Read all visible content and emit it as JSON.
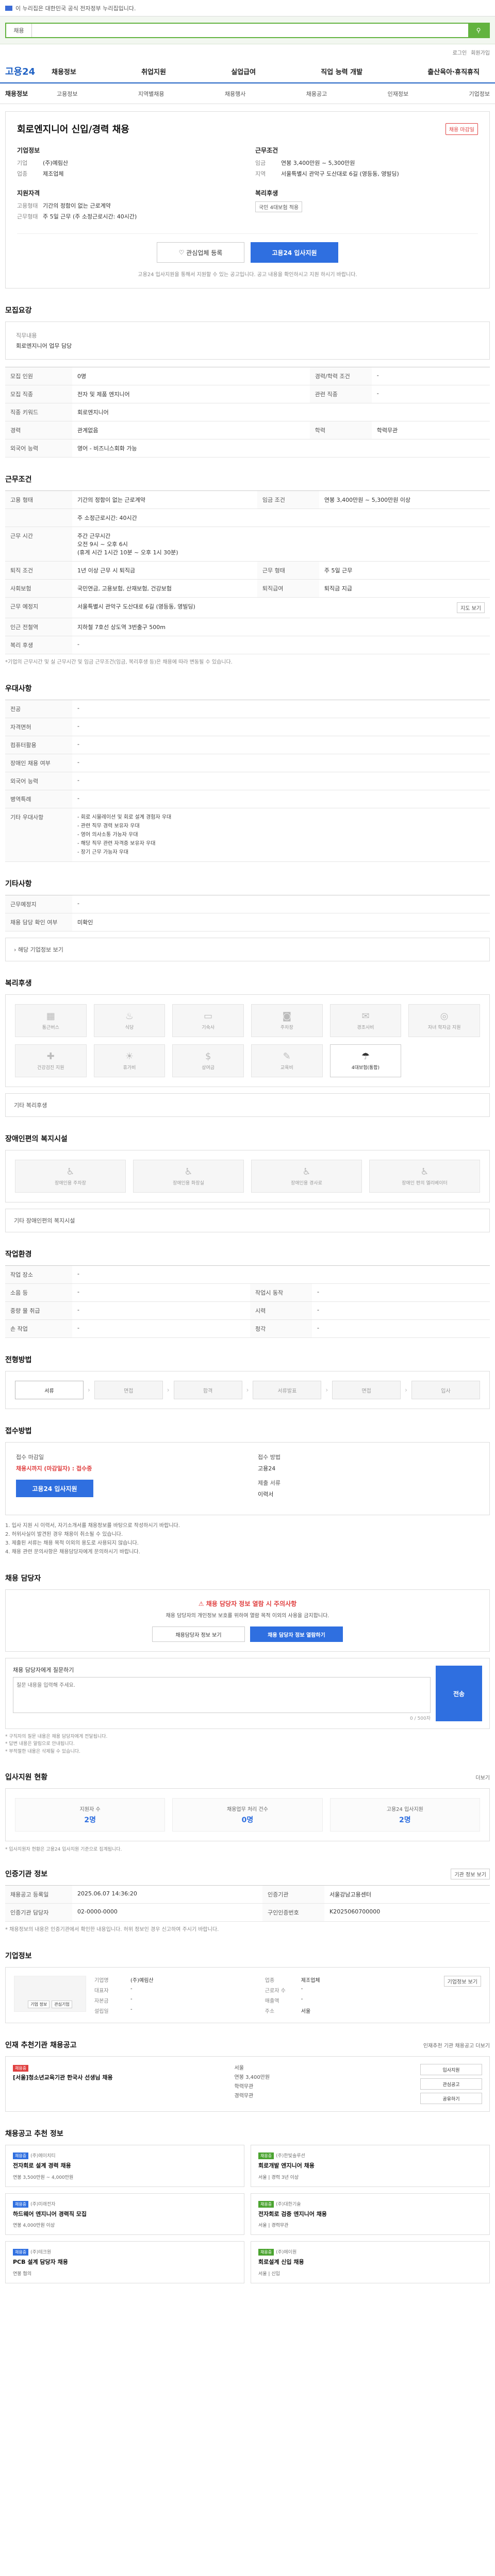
{
  "banner": {
    "text": "이 누리집은 대한민국 공식 전자정부 누리집입니다."
  },
  "search": {
    "scope": "채용",
    "placeholder": ""
  },
  "util": {
    "login": "로그인",
    "join": "회원가입"
  },
  "gnb": {
    "logo": "고용24",
    "items": [
      "채용정보",
      "취업지원",
      "실업급여",
      "직업 능력 개발",
      "출산육아·휴직휴직"
    ]
  },
  "lnb": {
    "title": "채용정보",
    "items": [
      "고용정보",
      "지역별채용",
      "채용행사",
      "채용공고",
      "인재정보",
      "기업정보"
    ]
  },
  "job": {
    "title": "회로엔지니어 신입/경력 채용",
    "tag": "채용 마감일",
    "company_heading": "기업정보",
    "company_rows": [
      {
        "k": "기업",
        "v": "(주)예림산"
      },
      {
        "k": "업종",
        "v": "제조업체"
      }
    ],
    "conditions_heading": "근무조건",
    "condition_rows": [
      {
        "k": "임금",
        "v": "연봉 3,400만원 ~ 5,300만원"
      },
      {
        "k": "지역",
        "v": "서울특별시 관악구 도산대로 6길 (영등동, 영빌딩)"
      }
    ],
    "qual_heading": "지원자격",
    "qual_rows": [
      {
        "k": "고용형태",
        "v": "기간의 정함이 없는 근로계약"
      },
      {
        "k": "근무형태",
        "v": "주 5일 근무 (주 소정근로시간: 40시간)"
      }
    ],
    "welfare_heading": "복리후생",
    "welfare_chip": "국민 4대보험 적용",
    "interest_btn": "관심업체 등록",
    "apply_btn": "고용24 입사지원",
    "note": "고용24 입사지원을 통해서 지원할 수 있는 공고입니다. 공고 내용을 확인하시고 지원 하시기 바랍니다."
  },
  "overview": {
    "title": "모집요강",
    "lbl": "직무내용",
    "txt": "회로엔지니어 업무 담당"
  },
  "recruit_table": [
    {
      "k": "모집 인원",
      "v": "0명",
      "k2": "경력/학력 조건",
      "v2": "-"
    },
    {
      "k": "모집 직종",
      "v": "전자 및 제품 엔지니어",
      "k2": "관련 직종",
      "v2": "-"
    },
    {
      "k": "직종 키워드",
      "v": "회로엔지니어",
      "k2": "",
      "v2": ""
    },
    {
      "k": "경력",
      "v": "관계없음",
      "k2": "학력",
      "v2": "학력무관"
    },
    {
      "k": "외국어 능력",
      "v": "영어 - 비즈니스회화 가능",
      "k2": "",
      "v2": ""
    }
  ],
  "conditions": {
    "title": "근무조건",
    "rows": [
      {
        "k": "고용 형태",
        "v": "기간의 정함이 없는 근로계약",
        "k2": "임금 조건",
        "v2": "연봉 3,400만원 ~ 5,300만원 이상"
      },
      {
        "k": "",
        "v": "주 소정근로시간: 40시간",
        "k2": "",
        "v2": ""
      },
      {
        "k": "근무 시간",
        "v": "주간 근무시간\n오전 9시 ~ 오후 6시\n(휴게 시간 1시간 10분 ~ 오후 1시 30분)",
        "k2": "",
        "v2": ""
      },
      {
        "k": "퇴직 조건",
        "v": "1년 이상 근무 시 퇴직금",
        "k2": "근무 형태",
        "v2": "주 5일 근무"
      },
      {
        "k": "사회보험",
        "v": "국민연금, 고용보험, 산재보험, 건강보험",
        "k2": "퇴직급여",
        "v2": "퇴직금 지급"
      },
      {
        "k": "근무 예정지",
        "v": "서울특별시 관악구 도산대로 6길 (영등동, 영빌딩)",
        "k2": "",
        "v2": ""
      },
      {
        "k": "인근 전철역",
        "v": "지하철 7호선 상도역 3번출구 500m",
        "k2": "",
        "v2": ""
      },
      {
        "k": "복리 후생",
        "v": "-",
        "k2": "",
        "v2": ""
      }
    ],
    "map_btn": "지도 보기",
    "notes": "*기업의 근무시간 및 실 근무시간 및 임금 근무조건(임금, 복리후생 등)은 채용에 따라 변동될 수 있습니다."
  },
  "preferred": {
    "title": "우대사항",
    "rows": [
      {
        "k": "전공",
        "v": "-"
      },
      {
        "k": "자격면허",
        "v": "-"
      },
      {
        "k": "컴퓨터활용",
        "v": "-"
      },
      {
        "k": "장애인 채용 여부",
        "v": "-"
      },
      {
        "k": "외국어 능력",
        "v": "-"
      },
      {
        "k": "병역특례",
        "v": "-"
      }
    ],
    "etc_label": "기타 우대사항",
    "etc_items": [
      "- 회로 시뮬레이션 및 회로 설계 경험자 우대",
      "- 관련 직무 경력 보유자 우대",
      "- 영어 의사소통 가능자 우대",
      "- 해당 직무 관련 자격증 보유자 우대",
      "- 장기 근무 가능자 우대"
    ]
  },
  "etc_info": {
    "title": "기타사항",
    "rows": [
      {
        "k": "근무예정지",
        "v": "-"
      },
      {
        "k": "채용 담당 확인 여부",
        "v": "미확인"
      }
    ],
    "link": "해당 기업정보 보기"
  },
  "welfare": {
    "title": "복리후생",
    "items": [
      {
        "icon": "building-icon",
        "label": "통근버스",
        "on": false
      },
      {
        "icon": "meal-icon",
        "label": "식당",
        "on": false
      },
      {
        "icon": "bed-icon",
        "label": "기숙사",
        "on": false
      },
      {
        "icon": "car-icon",
        "label": "주차장",
        "on": false
      },
      {
        "icon": "gift-icon",
        "label": "경조사비",
        "on": false
      },
      {
        "icon": "coin-icon",
        "label": "자녀 학자금 지원",
        "on": false
      },
      {
        "icon": "health-icon",
        "label": "건강검진 지원",
        "on": false
      },
      {
        "icon": "vacation-icon",
        "label": "휴가비",
        "on": false
      },
      {
        "icon": "bonus-icon",
        "label": "상여금",
        "on": false
      },
      {
        "icon": "edu-icon",
        "label": "교육비",
        "on": false
      },
      {
        "icon": "insurance-icon",
        "label": "4대보험(통합)",
        "on": true
      }
    ],
    "etc_label": "기타 복리후생"
  },
  "disabled": {
    "title": "장애인편의 복지시설",
    "items": [
      "장애인용 주차장",
      "장애인용 화장실",
      "장애인용 경사로",
      "장애인 편의 엘리베이터"
    ],
    "etc_label": "기타 장애인편의 복지시설"
  },
  "workenv": {
    "title": "작업환경",
    "rows": [
      {
        "k": "작업 장소",
        "v": "-",
        "k2": "",
        "v2": ""
      },
      {
        "k": "소음 등",
        "v": "-",
        "k2": "작업시 동작",
        "v2": "-"
      },
      {
        "k": "중량 물 취급",
        "v": "-",
        "k2": "시력",
        "v2": "-"
      },
      {
        "k": "손 작업",
        "v": "-",
        "k2": "청각",
        "v2": "-"
      }
    ]
  },
  "process": {
    "title": "전형방법",
    "steps": [
      "서류",
      "면접",
      "합격",
      "서류발표",
      "면접",
      "입사"
    ]
  },
  "apply": {
    "title": "접수방법",
    "period_label": "접수 마감일",
    "period_value": "채용시까지 (마감일자) : 접수중",
    "method_btn": "고용24 입사지원",
    "type_label": "접수 방법",
    "type_value": "고용24",
    "doc_label": "제출 서류",
    "doc_value": "이력서",
    "notes": [
      "1. 입사 지원 시 이력서, 자기소개서를 채용정보를 바탕으로 작성하시기 바랍니다.",
      "2. 허위사실이 발견된 경우 채용이 취소될 수 있습니다.",
      "3. 제출된 서류는 채용 목적 이외의 용도로 사용되지 않습니다.",
      "4. 채용 관련 문의사항은 채용담당자에게 문의하시기 바랍니다."
    ]
  },
  "manager": {
    "title": "채용 담당자",
    "warn_title": "채용 담당자 정보 열람 시 주의사항",
    "warn_text": "채용 담당자의 개인정보 보호를 위하여 열람 목적 이외의 사용을 금지합니다.",
    "btn_view": "채용담당자 정보 보기",
    "btn_apply": "채용 담당자 정보 열람하기",
    "qna_label": "채용 담당자에게 질문하기",
    "qna_placeholder": "질문 내용을 입력해 주세요.",
    "qna_count": "0 / 500자",
    "send_label": "전송",
    "qna_notes": [
      "* 구직자의 질문 내용은 채용 담당자에게 전달됩니다.",
      "* 답변 내용은 알림으로 안내됩니다.",
      "* 부적절한 내용은 삭제될 수 있습니다."
    ]
  },
  "stats": {
    "title": "입사지원 현황",
    "more": "더보기",
    "items": [
      {
        "label": "지원자 수",
        "num": "2명"
      },
      {
        "label": "채용업무 처리 건수",
        "num": "0명"
      },
      {
        "label": "고용24 입사지원",
        "num": "2명"
      }
    ],
    "note": "* 입사지원자 현황은 고용24 입사지원 기준으로 집계됩니다."
  },
  "info": {
    "title": "인증기관 정보",
    "btn": "기관 정보 보기",
    "rows": [
      {
        "k": "채용공고 등록일",
        "v": "2025.06.07 14:36:20",
        "k2": "인증기관",
        "v2": "서울강남고용센터"
      },
      {
        "k": "인증기관 담당자",
        "v": "02-0000-0000",
        "k2": "구인인증번호",
        "v2": "K2025060700000"
      }
    ],
    "notes": "* 채용정보의 내용은 인증기관에서 확인한 내용입니다. 허위 정보인 경우 신고하여 주시기 바랍니다."
  },
  "company": {
    "title": "기업정보",
    "logo_btns": [
      "기업 정보",
      "관심기업"
    ],
    "rows": [
      {
        "k": "기업명",
        "v": "(주)예림산",
        "k2": "업종",
        "v2": "제조업체"
      },
      {
        "k": "대표자",
        "v": "-",
        "k2": "근로자 수",
        "v2": "-"
      },
      {
        "k": "자본금",
        "v": "-",
        "k2": "매출액",
        "v2": "-"
      },
      {
        "k": "설립일",
        "v": "-",
        "k2": "주소",
        "v2": "서울"
      }
    ],
    "side_btn": "기업정보 보기"
  },
  "other_jobs": {
    "title": "인재 추천기관 채용공고",
    "more": "인재추천 기관 채용공고 더보기",
    "badge": "채용중",
    "job_title": "[서울]청소년교육기관 한국사 선생님 채용",
    "meta": [
      "서울",
      "연봉 3,400만원",
      "학력무관",
      "경력무관"
    ],
    "btns": [
      "입사지원",
      "관심공고",
      "공유하기"
    ]
  },
  "recommend": {
    "title": "채용공고 추천 정보",
    "items": [
      {
        "badge": "채용중",
        "color": "blue",
        "co": "(주)에이치티",
        "title": "전자회로 설계 경력 채용",
        "meta": "연봉 3,500만원 ~ 4,000만원"
      },
      {
        "badge": "채용중",
        "color": "green",
        "co": "(주)한빛솔루션",
        "title": "회로개발 엔지니어 채용",
        "meta": "서울 | 경력 3년 이상"
      },
      {
        "badge": "채용중",
        "color": "blue",
        "co": "(주)미래전자",
        "title": "하드웨어 엔지니어 경력직 모집",
        "meta": "연봉 4,000만원 이상"
      },
      {
        "badge": "채용중",
        "color": "green",
        "co": "(주)대한기술",
        "title": "전자회로 검증 엔지니어 채용",
        "meta": "서울 | 경력무관"
      },
      {
        "badge": "채용중",
        "color": "blue",
        "co": "(주)테크원",
        "title": "PCB 설계 담당자 채용",
        "meta": "연봉 협의"
      },
      {
        "badge": "채용중",
        "color": "green",
        "co": "(주)에이원",
        "title": "회로설계 신입 채용",
        "meta": "서울 | 신입"
      }
    ]
  }
}
